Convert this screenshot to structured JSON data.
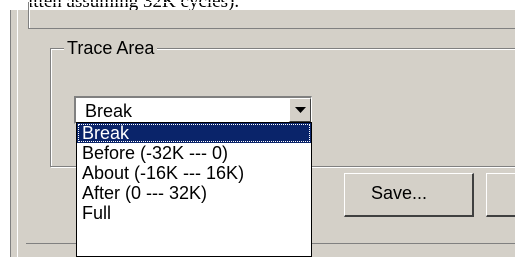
{
  "doc_text": "itten assuming 32K cycles).",
  "trace_area": {
    "title": "Trace Area",
    "selected": "Break",
    "options": [
      "Break",
      "Before (-32K --- 0)",
      "About (-16K --- 16K)",
      "After (0 --- 32K)",
      "Full"
    ]
  },
  "buttons": {
    "save": "Save..."
  }
}
